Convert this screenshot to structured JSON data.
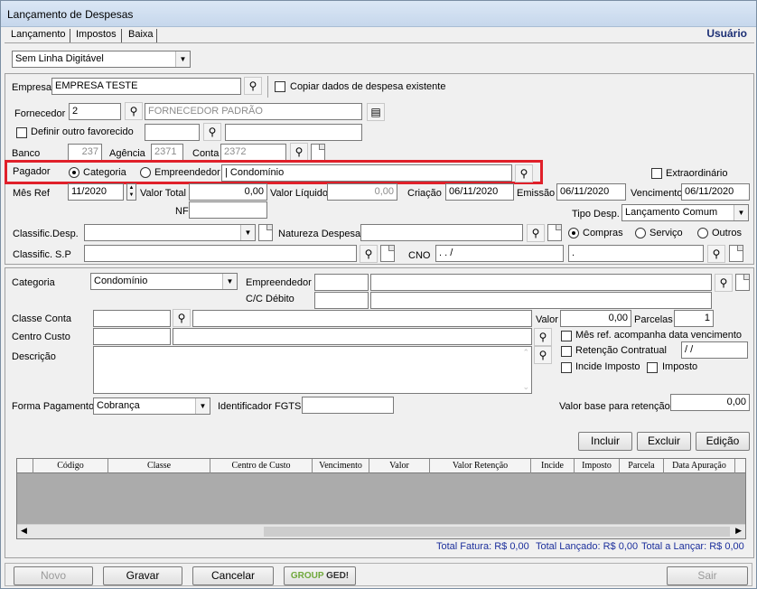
{
  "window": {
    "title": "Lançamento de Despesas"
  },
  "tabs": [
    "Lançamento",
    "Impostos",
    "Baixa"
  ],
  "user_label": "Usuário",
  "top_select": "Sem Linha Digitável",
  "empresa": {
    "label": "Empresa",
    "value": "EMPRESA TESTE",
    "copy_label": "Copiar dados de despesa existente"
  },
  "fornecedor": {
    "label": "Fornecedor",
    "code": "2",
    "name": "FORNECEDOR PADRÃO"
  },
  "favorecido": {
    "label": "Definir outro favorecido"
  },
  "banco": {
    "label": "Banco",
    "value": "237",
    "agencia_label": "Agência",
    "agencia": "2371",
    "conta_label": "Conta",
    "conta": "2372"
  },
  "pagador": {
    "label": "Pagador",
    "opt1": "Categoria",
    "opt2": "Empreendedor",
    "value": "| Condomínio"
  },
  "extraordinario": "Extraordinário",
  "mes_ref": {
    "label": "Mês Ref",
    "value": "11/2020"
  },
  "valor_total": {
    "label": "Valor Total",
    "value": "0,00"
  },
  "valor_liquido": {
    "label": "Valor Líquido",
    "value": "0,00"
  },
  "criacao": {
    "label": "Criação",
    "value": "06/11/2020"
  },
  "emissao": {
    "label": "Emissão",
    "value": "06/11/2020"
  },
  "vencimento": {
    "label": "Vencimento",
    "value": "06/11/2020"
  },
  "nf": {
    "label": "NF"
  },
  "tipo_desp": {
    "label": "Tipo Desp.",
    "value": "Lançamento Comum"
  },
  "classif_desp": {
    "label": "Classific.Desp."
  },
  "natureza": {
    "label": "Natureza Despesa"
  },
  "natureza_opts": [
    "Compras",
    "Serviço",
    "Outros"
  ],
  "classif_sp": {
    "label": "Classific. S.P"
  },
  "cno": {
    "label": "CNO",
    "value": ".   .      /",
    "value2": "."
  },
  "categoria": {
    "label": "Categoria",
    "value": "Condomínio"
  },
  "empreendedor": {
    "label": "Empreendedor"
  },
  "cc_debito": {
    "label": "C/C Débito"
  },
  "classe_conta": {
    "label": "Classe Conta"
  },
  "valor": {
    "label": "Valor",
    "value": "0,00"
  },
  "parcelas": {
    "label": "Parcelas",
    "value": "1"
  },
  "centro_custo": {
    "label": "Centro Custo"
  },
  "mes_ref_venc": "Mês ref. acompanha data vencimento",
  "retencao": {
    "label": "Retenção Contratual",
    "value": " /  /"
  },
  "descricao": {
    "label": "Descrição"
  },
  "incide_imposto": "Incide Imposto",
  "imposto": "Imposto",
  "forma_pagamento": {
    "label": "Forma Pagamento",
    "value": "Cobrança"
  },
  "identificador_fgts": {
    "label": "Identificador FGTS"
  },
  "valor_base": {
    "label": "Valor base para retenção",
    "value": "0,00"
  },
  "grid_buttons": {
    "incluir": "Incluir",
    "excluir": "Excluir",
    "edicao": "Edição"
  },
  "grid_columns": [
    "Código",
    "Classe",
    "Centro de Custo",
    "Vencimento",
    "Valor",
    "Valor Retenção",
    "Incide",
    "Imposto",
    "Parcela",
    "Data Apuração"
  ],
  "totals": {
    "fatura": "Total Fatura: R$ 0,00",
    "lancado": "Total Lançado: R$ 0,00",
    "a_lancar": "Total a Lançar: R$ 0,00"
  },
  "footer": {
    "novo": "Novo",
    "gravar": "Gravar",
    "cancelar": "Cancelar",
    "group": "GROUP",
    "ged": "GED!",
    "sair": "Sair"
  },
  "colors": {
    "highlight": "#e0202a",
    "title_bg": "#c6d7ec",
    "totals_text": "#1c2f9c",
    "user_label": "#1c2f75"
  }
}
